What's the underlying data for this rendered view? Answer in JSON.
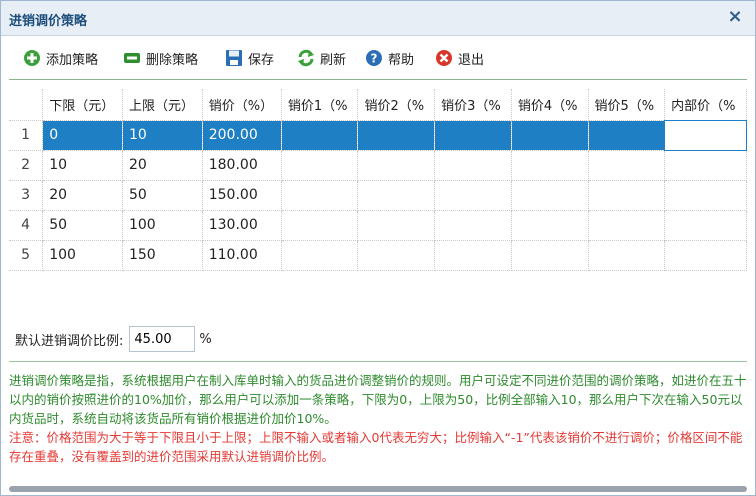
{
  "window": {
    "title": "进销调价策略"
  },
  "toolbar": {
    "add": "添加策略",
    "delete": "删除策略",
    "save": "保存",
    "refresh": "刷新",
    "help": "帮助",
    "exit": "退出"
  },
  "columns": [
    "下限（元）",
    "上限（元）",
    "销价（%）",
    "销价1（%",
    "销价2（%",
    "销价3（%",
    "销价4（%",
    "销价5（%",
    "内部价（%"
  ],
  "rows": [
    {
      "n": "1",
      "lower": "0",
      "upper": "10",
      "price": "200.00"
    },
    {
      "n": "2",
      "lower": "10",
      "upper": "20",
      "price": "180.00"
    },
    {
      "n": "3",
      "lower": "20",
      "upper": "50",
      "price": "150.00"
    },
    {
      "n": "4",
      "lower": "50",
      "upper": "100",
      "price": "130.00"
    },
    {
      "n": "5",
      "lower": "100",
      "upper": "150",
      "price": "110.00"
    }
  ],
  "default": {
    "label": "默认进销调价比例:",
    "value": "45.00",
    "unit": "%"
  },
  "help": {
    "description": "进销调价策略是指，系统根据用户在制入库单时输入的货品进价调整销价的规则。用户可设定不同进价范围的调价策略，如进价在五十以内的销价按照进价的10%加价，那么用户可以添加一条策略，下限为0，上限为50，比例全部输入10，那么用户下次在输入50元以内货品时，系统自动将该货品所有销价根据进价加价10%。",
    "note": "注意：价格范围为大于等于下限且小于上限；上限不输入或者输入0代表无穷大；比例输入“-1”代表该销价不进行调价；价格区间不能存在重叠，没有覆盖到的进价范围采用默认进销调价比例。"
  },
  "colors": {
    "selected_row": "#1e7fc4",
    "title": "#1d4f7d",
    "help_green": "#2e8b2e",
    "help_red": "#e53935"
  }
}
